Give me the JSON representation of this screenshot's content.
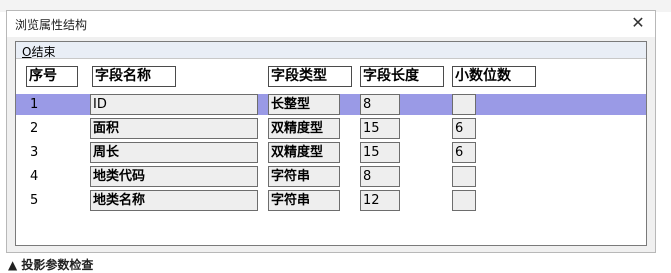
{
  "window": {
    "title": "浏览属性结构",
    "close_glyph": "✕"
  },
  "menu": {
    "end_mnemonic": "O",
    "end_label": "结束"
  },
  "columns": [
    "序号",
    "字段名称",
    "字段类型",
    "字段长度",
    "小数位数"
  ],
  "rows": [
    {
      "num": "1",
      "name": "ID",
      "type": "长整型",
      "length": "8",
      "decimals": "",
      "selected": true
    },
    {
      "num": "2",
      "name": "面积",
      "type": "双精度型",
      "length": "15",
      "decimals": "6"
    },
    {
      "num": "3",
      "name": "周长",
      "type": "双精度型",
      "length": "15",
      "decimals": "6"
    },
    {
      "num": "4",
      "name": "地类代码",
      "type": "字符串",
      "length": "8",
      "decimals": ""
    },
    {
      "num": "5",
      "name": "地类名称",
      "type": "字符串",
      "length": "12",
      "decimals": ""
    }
  ],
  "footer": {
    "text": "▲ 投影参数检查"
  },
  "colors": {
    "selection": "#9a9ae6",
    "cell_bg": "#eeeeee",
    "header_border": "#4b4b4b"
  }
}
